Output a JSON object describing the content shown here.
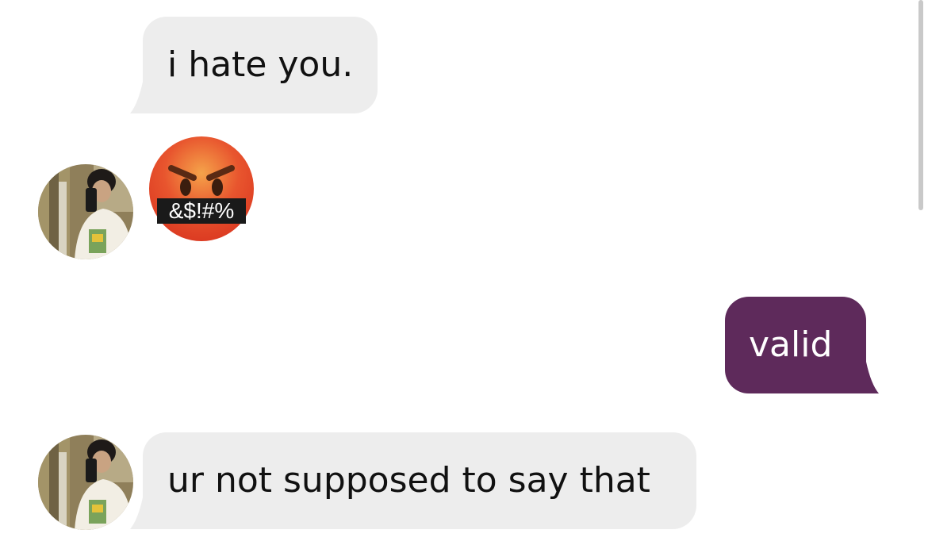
{
  "messages": [
    {
      "direction": "incoming",
      "text": "i hate you."
    },
    {
      "direction": "incoming",
      "type": "emoji",
      "emoji_name": "face-with-symbols-on-mouth",
      "symbols": "&$!#%"
    },
    {
      "direction": "outgoing",
      "text": "valid"
    },
    {
      "direction": "incoming",
      "text": "ur not supposed to say that"
    }
  ],
  "colors": {
    "incoming_bubble": "#ededed",
    "outgoing_bubble": "#5e2a5b",
    "incoming_text": "#111111",
    "outgoing_text": "#ffffff"
  }
}
